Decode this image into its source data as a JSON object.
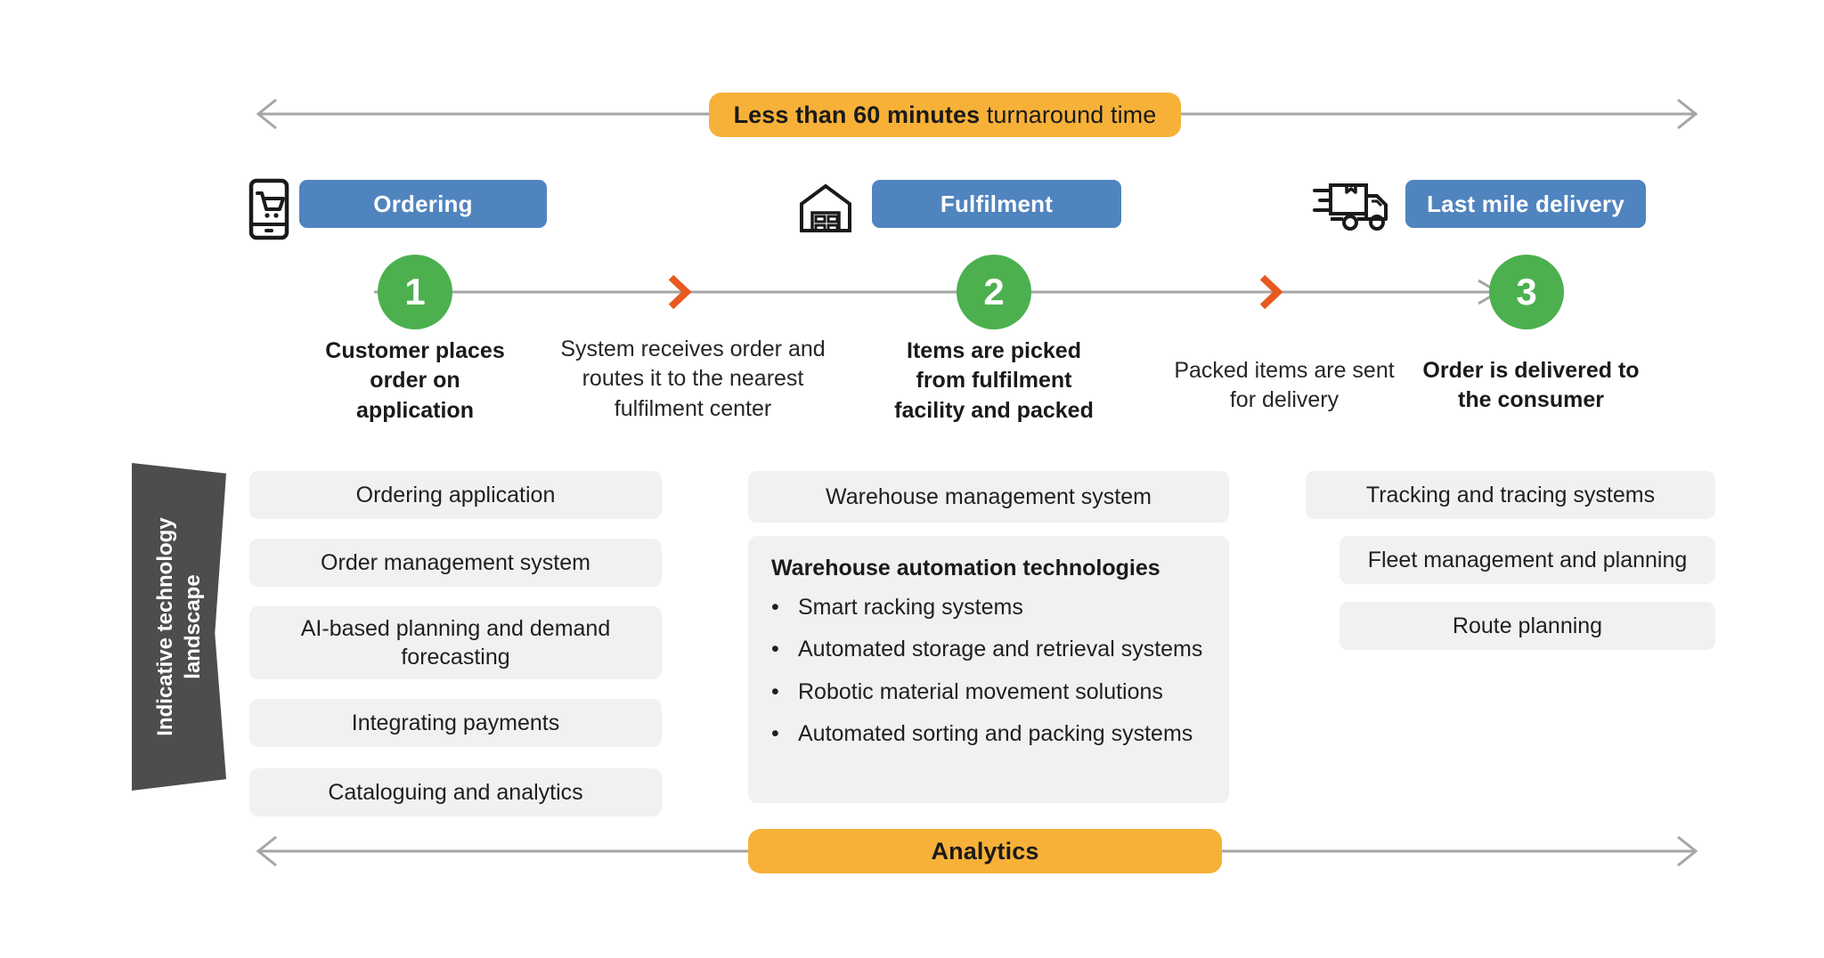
{
  "top_band": {
    "banner_bold": "Less than 60 minutes",
    "banner_rest": " turnaround time",
    "arrow_left_icon": "arrow-left-icon",
    "arrow_right_icon": "arrow-right-icon"
  },
  "stages": [
    {
      "icon": "mobile-cart-icon",
      "label": "Ordering"
    },
    {
      "icon": "warehouse-icon",
      "label": "Fulfilment"
    },
    {
      "icon": "delivery-truck-icon",
      "label": "Last mile delivery"
    }
  ],
  "steps": [
    {
      "number": "1",
      "label": "Customer places order on application"
    },
    {
      "number": "2",
      "label": "Items are picked from fulfilment facility and packed"
    },
    {
      "number": "3",
      "label": "Order is delivered to the consumer"
    }
  ],
  "connectors": [
    {
      "label": "System receives order and routes it to the nearest fulfilment center"
    },
    {
      "label": "Packed items are sent for delivery"
    }
  ],
  "tech_landscape": {
    "banner_label": "Indicative technology landscape",
    "columns": [
      {
        "name": "ordering",
        "cards": [
          {
            "text": "Ordering application"
          },
          {
            "text": "Order management system"
          },
          {
            "text": "AI-based planning and demand forecasting"
          },
          {
            "text": "Integrating payments"
          },
          {
            "text": "Cataloguing and analytics"
          }
        ]
      },
      {
        "name": "fulfilment",
        "cards": [
          {
            "text": "Warehouse management system"
          }
        ],
        "block": {
          "title": "Warehouse automation technologies",
          "bullet_char": "•",
          "bullets": [
            "Smart racking systems",
            "Automated storage and retrieval systems",
            "Robotic material movement solutions",
            "Automated sorting and packing systems"
          ]
        }
      },
      {
        "name": "last-mile",
        "cards": [
          {
            "text": "Tracking and tracing systems"
          },
          {
            "text": "Fleet management and planning"
          },
          {
            "text": "Route planning"
          }
        ]
      }
    ]
  },
  "bottom_band": {
    "banner_label": "Analytics",
    "arrow_left_icon": "arrow-left-icon",
    "arrow_right_icon": "arrow-right-icon"
  },
  "colors": {
    "accent_orange": "#f7b138",
    "stage_blue": "#5084be",
    "step_green": "#4cb04f",
    "chevron_orange": "#e8591f",
    "dark_banner": "#4d4d4d",
    "card_gray": "#f1f1f1",
    "line_gray": "#a6a6a6"
  }
}
